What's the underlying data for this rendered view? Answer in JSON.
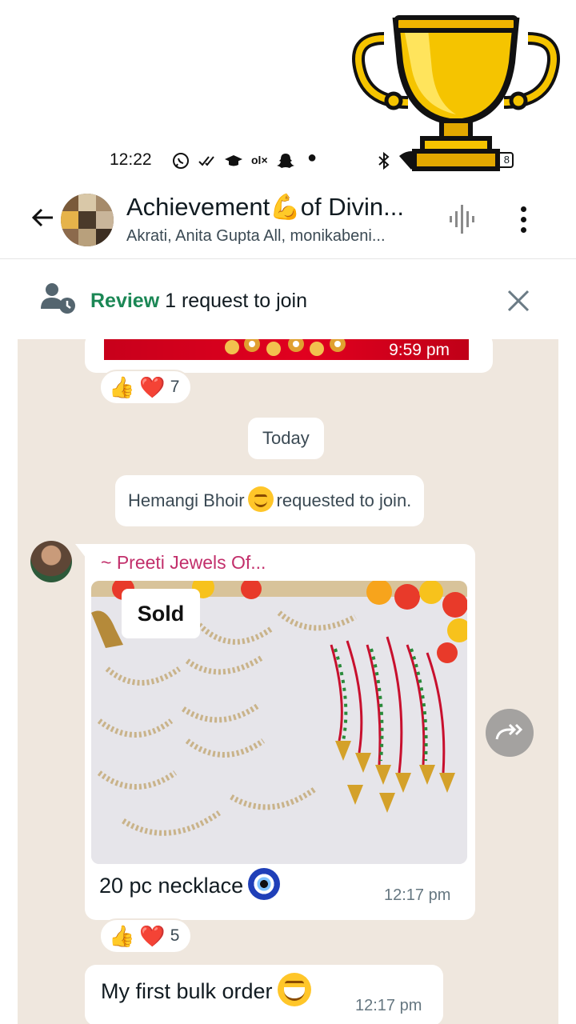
{
  "status_bar": {
    "time": "12:22",
    "battery": "8",
    "icons": [
      "whatsapp-icon",
      "double-check-icon",
      "graduation-cap-icon",
      "olx-icon",
      "snapchat-icon",
      "dot-icon",
      "bluetooth-icon",
      "wifi-icon",
      "battery-icon"
    ]
  },
  "header": {
    "title": "Achievement💪of Divin...",
    "subtitle": "Akrati, Anita Gupta All, monikabeni..."
  },
  "join_banner": {
    "review_label": "Review",
    "request_text": "1 request to join"
  },
  "chat": {
    "previous_message": {
      "time": "9:59 pm",
      "reactions": {
        "emojis": [
          "👍",
          "❤️"
        ],
        "count": "7"
      }
    },
    "date_chip": "Today",
    "system_message": {
      "name": "Hemangi Bhoir",
      "emoji": "😊",
      "text": "requested to join."
    },
    "image_message": {
      "sender": "~ Preeti Jewels Of...",
      "overlay_tag": "Sold",
      "caption": "20 pc necklace",
      "caption_emoji": "🧿",
      "time": "12:17 pm",
      "reactions": {
        "emojis": [
          "👍",
          "❤️"
        ],
        "count": "5"
      }
    },
    "text_message": {
      "text": "My first bulk order",
      "emoji": "😄",
      "time": "12:17 pm"
    }
  },
  "colors": {
    "chat_background": "#efe7de",
    "review_green": "#1b8755",
    "sender_name": "#c22f6b",
    "trophy_gold": "#f5c400"
  }
}
